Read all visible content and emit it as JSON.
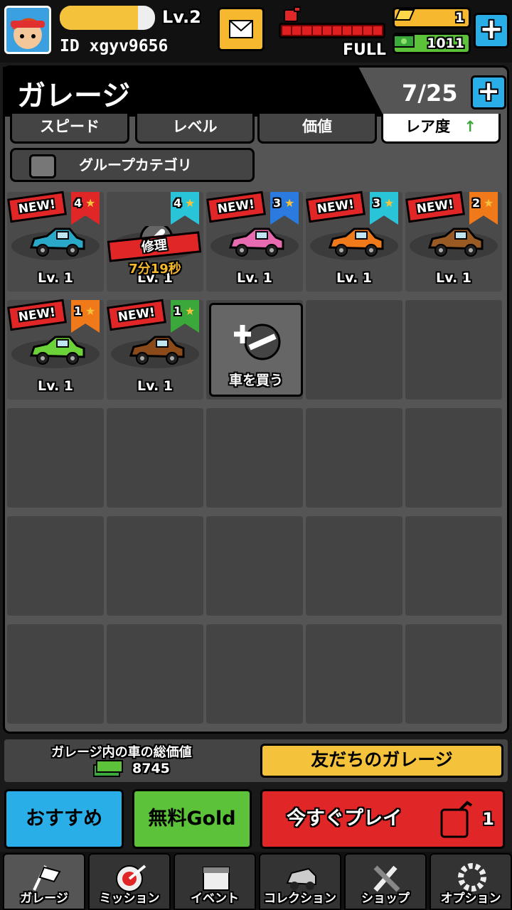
{
  "player": {
    "level": "Lv.2",
    "id": "ID xgyv9656",
    "xp_fraction": 0.82
  },
  "fuel": {
    "status": "FULL",
    "segments": 10,
    "filled": 10
  },
  "currency": {
    "gold": "1",
    "cash": "1011"
  },
  "garage": {
    "title": "ガレージ",
    "count": "7/25"
  },
  "sort": {
    "speed": "スピード",
    "level": "レベル",
    "value": "価値",
    "rarity": "レア度",
    "group": "グループカテゴリ"
  },
  "new_label": "NEW!",
  "cars": [
    {
      "stars": "4",
      "level": "Lv. 1",
      "color": "#2aa8c8",
      "ribbon": "#e02626",
      "new": true
    },
    {
      "stars": "4",
      "level": "Lv. 1",
      "ribbon": "#29c4d8",
      "repair_label": "修理",
      "repair_time": "7分19秒"
    },
    {
      "stars": "3",
      "level": "Lv. 1",
      "color": "#e86ab0",
      "ribbon": "#2a7ae0",
      "new": true
    },
    {
      "stars": "3",
      "level": "Lv. 1",
      "color": "#f07a1a",
      "ribbon": "#29c4d8",
      "new": true
    },
    {
      "stars": "2",
      "level": "Lv. 1",
      "color": "#9a5a24",
      "ribbon": "#f07a1a",
      "new": true
    },
    {
      "stars": "1",
      "level": "Lv. 1",
      "color": "#6cd23a",
      "ribbon": "#f07a1a",
      "new": true
    },
    {
      "stars": "1",
      "level": "Lv. 1",
      "color": "#8a4a1a",
      "ribbon": "#3aa83a",
      "new": true
    }
  ],
  "buy_car": "車を買う",
  "total_value": {
    "label": "ガレージ内の車の総価値",
    "amount": "8745"
  },
  "friends_garage": "友だちのガレージ",
  "actions": {
    "recommend": "おすすめ",
    "free_gold": "無料Gold",
    "play_now": "今すぐプレイ",
    "play_count": "1"
  },
  "nav": [
    {
      "label": "ガレージ",
      "icon": "flag-icon"
    },
    {
      "label": "ミッション",
      "icon": "target-icon"
    },
    {
      "label": "イベント",
      "icon": "calendar-icon"
    },
    {
      "label": "コレクション",
      "icon": "car-icon"
    },
    {
      "label": "ショップ",
      "icon": "tools-icon"
    },
    {
      "label": "オプション",
      "icon": "gear-icon"
    }
  ],
  "colors": {
    "accent_blue": "#29aee8",
    "gold": "#f5b82e",
    "green": "#5cc23a",
    "red": "#e02626"
  }
}
